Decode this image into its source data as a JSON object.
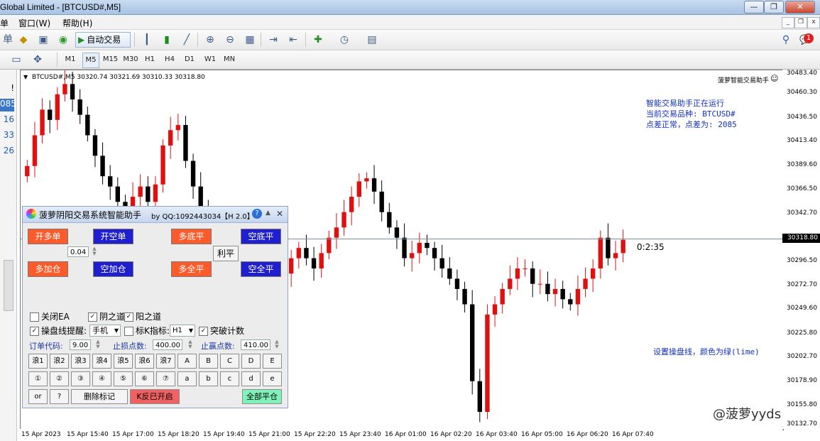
{
  "window": {
    "title": "Global Limited - [BTCUSD#,M5]"
  },
  "menu": {
    "item_partial": "单",
    "window": "窗口(W)",
    "help": "帮助(H)"
  },
  "toolbar": {
    "autotrade_label": "自动交易",
    "timeframes": [
      "M1",
      "M5",
      "M15",
      "M30",
      "H1",
      "H4",
      "D1",
      "W1",
      "MN"
    ],
    "active_timeframe": "M5",
    "notification_count": "1"
  },
  "left_panel": {
    "values": [
      "!",
      "085",
      "16",
      "33",
      "26"
    ]
  },
  "chart": {
    "header": "BTCUSD#,M5  30320.74 30321.69 30310.33 30318.80",
    "ea_name": "菠萝智能交易助手",
    "info_lines": [
      "智能交易助手正在运行",
      "当前交易品种: BTCUSD#",
      "点差正常，点差为: 2085"
    ],
    "line_note": "设置操盘线，颜色为绿(lime)",
    "countdown": "0:2:35",
    "watermark": "@菠萝yyds",
    "current_price": "30318.80",
    "price_labels": [
      "30483.40",
      "30460.30",
      "30436.50",
      "30413.40",
      "30389.60",
      "30366.50",
      "30342.70",
      "30318.80",
      "30296.50",
      "30272.70",
      "30249.60",
      "30225.80",
      "30202.70",
      "30178.90",
      "30155.80",
      "30132.70"
    ],
    "time_labels": [
      "15 Apr 2023",
      "15 Apr 15:40",
      "15 Apr 17:00",
      "15 Apr 18:20",
      "15 Apr 19:40",
      "15 Apr 21:00",
      "15 Apr 22:20",
      "15 Apr 23:40",
      "16 Apr 01:00",
      "16 Apr 02:20",
      "16 Apr 03:40",
      "16 Apr 05:00",
      "16 Apr 06:20",
      "16 Apr 07:40"
    ]
  },
  "chart_data": {
    "type": "candlestick",
    "symbol": "BTCUSD#",
    "timeframe": "M5",
    "ylim": [
      30132.7,
      30483.4
    ],
    "close_series": [
      30390,
      30420,
      30445,
      30435,
      30460,
      30470,
      30455,
      30440,
      30420,
      30400,
      30380,
      30370,
      30355,
      30340,
      30360,
      30370,
      30355,
      30372,
      30410,
      30425,
      30430,
      30395,
      30370,
      30345,
      30320,
      30310,
      30300,
      30295,
      30290,
      30280,
      30300,
      30318,
      30305,
      30290,
      30285,
      30300,
      30310,
      30300,
      30290,
      30305,
      30320,
      30330,
      30345,
      30360,
      30375,
      30378,
      30365,
      30345,
      30330,
      30320,
      30300,
      30305,
      30315,
      30310,
      30300,
      30290,
      30280,
      30270,
      30255,
      30180,
      30150,
      30245,
      30255,
      30270,
      30280,
      30290,
      30290,
      30275,
      30275,
      30265,
      30270,
      30260,
      30255,
      30270,
      30280,
      30290,
      30320,
      30300,
      30305,
      30318
    ]
  },
  "panel": {
    "title": "菠萝阴阳交易系统智能助手",
    "byline": "by QQ:1092443034【H 2.0】",
    "buttons": {
      "open_long": "开多单",
      "open_short": "开空单",
      "close_long": "多底平",
      "close_short": "空底平",
      "add_long": "多加仓",
      "add_short": "空加仓",
      "all_long_close": "多全平",
      "all_short_close": "空全平",
      "profit_close": "利平"
    },
    "lot": "0.04",
    "checks": {
      "close_ea": "关闭EA",
      "yin": "阴之道",
      "yang": "阳之道",
      "line_alert": "操盘线提醒:",
      "k_indicator": "标K指标:",
      "breakout": "突破计数"
    },
    "check_states": {
      "close_ea": false,
      "yin": true,
      "yang": true,
      "line_alert": true,
      "k_indicator": false,
      "breakout": true
    },
    "alert_mode": "手机",
    "k_period": "H1",
    "order_code_label": "订单代码:",
    "order_code": "9.00",
    "sl_label": "止损点数:",
    "sl": "400.00",
    "tp_label": "止赢点数:",
    "tp": "410.00",
    "grid_row1": [
      "浪1",
      "浪2",
      "浪3",
      "浪4",
      "浪5",
      "浪6",
      "浪7",
      "A",
      "B",
      "C",
      "D",
      "E"
    ],
    "grid_row2": [
      "①",
      "②",
      "③",
      "④",
      "⑤",
      "⑥",
      "⑦",
      "a",
      "b",
      "c",
      "d",
      "e"
    ],
    "bottom": {
      "or": "or",
      "q": "?",
      "delete_marks": "删除标记",
      "k_reverse": "K反已开启",
      "close_all": "全部平仓"
    }
  }
}
